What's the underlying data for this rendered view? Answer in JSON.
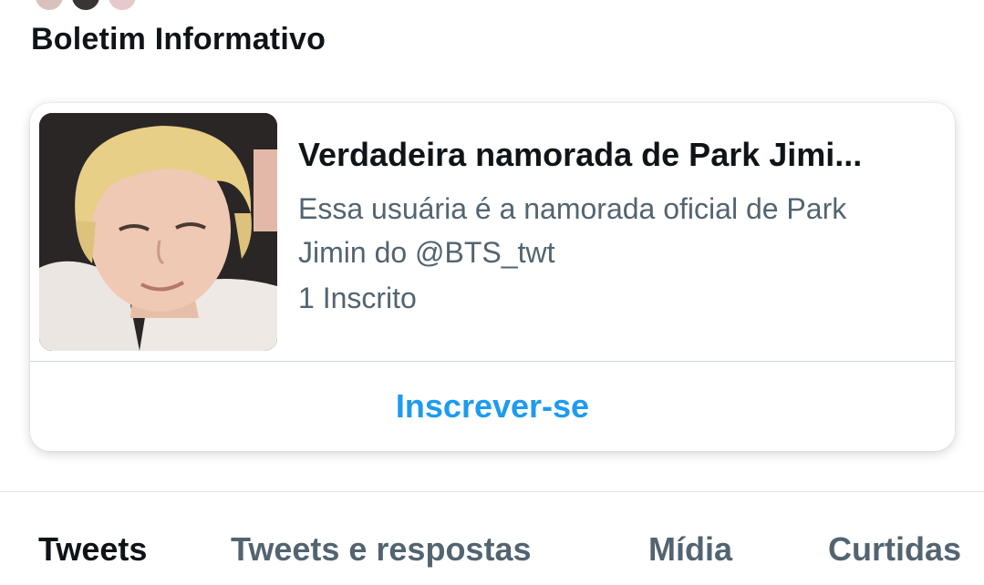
{
  "section": {
    "title": "Boletim Informativo"
  },
  "newsletter": {
    "title": "Verdadeira namorada de Park Jimi...",
    "description_line1": "Essa usuária é a namorada oficial de Park",
    "description_line2": "Jimin do @BTS_twt",
    "subscribers": "1 Inscrito",
    "subscribe_label": "Inscrever-se",
    "thumbnail_icon": "profile-photo"
  },
  "tabs": [
    {
      "label": "Tweets",
      "active": true
    },
    {
      "label": "Tweets e respostas",
      "active": false
    },
    {
      "label": "Mídia",
      "active": false
    },
    {
      "label": "Curtidas",
      "active": false
    }
  ],
  "colors": {
    "accent": "#1d9bf0",
    "text_primary": "#0f1419",
    "text_secondary": "#536471"
  }
}
